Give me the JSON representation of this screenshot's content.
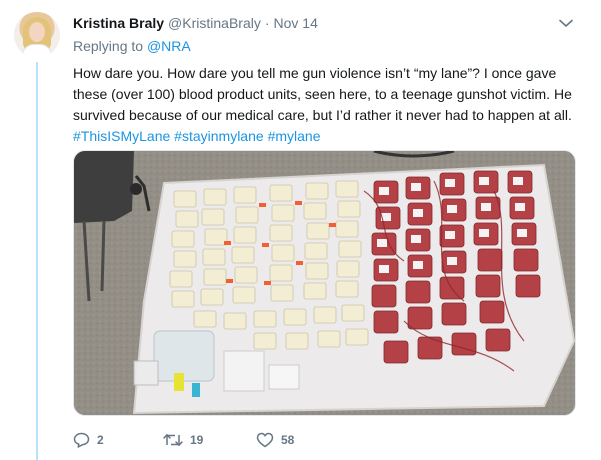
{
  "tweet": {
    "author_name": "Kristina Braly",
    "author_handle": "@KristinaBraly",
    "separator": "·",
    "date": "Nov 14",
    "reply_prefix": "Replying to",
    "reply_mention": "@NRA",
    "text_lines": [
      "How dare you. How dare you tell me gun violence isn’t “my lane”? I once gave",
      "these (over 100) blood product units, seen here, to a teenage gunshot victim. He",
      "survived because of our medical care, but I’d rather it never had to happen at all."
    ],
    "hashtags": [
      "#ThisISMyLane",
      "#stayinmylane",
      "#mylane"
    ]
  },
  "actions": {
    "reply_count": "2",
    "retweet_count": "19",
    "like_count": "58"
  },
  "icons": {
    "caret": "chevron-down-icon",
    "reply": "reply-icon",
    "retweet": "retweet-icon",
    "like": "heart-icon"
  },
  "colors": {
    "link": "#1b95e0",
    "secondary_text": "#657786",
    "thread_line": "#b8e1fa"
  }
}
